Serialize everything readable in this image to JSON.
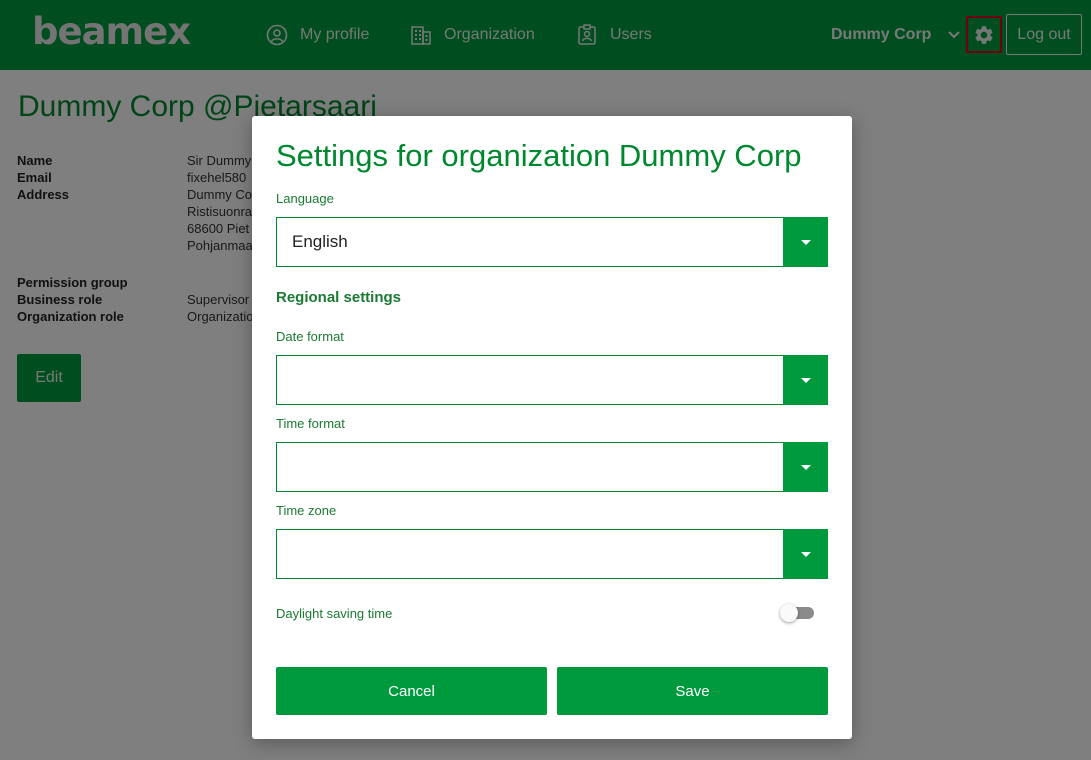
{
  "header": {
    "logo": "beamex",
    "nav": [
      {
        "label": "My profile",
        "icon": "user-circle-icon"
      },
      {
        "label": "Organization",
        "icon": "building-icon"
      },
      {
        "label": "Users",
        "icon": "id-badge-icon"
      }
    ],
    "org_selector": "Dummy Corp",
    "logout_label": "Log out"
  },
  "page": {
    "title": "Dummy Corp @Pietarsaari",
    "details": [
      {
        "label": "Name",
        "value": "Sir Dummy"
      },
      {
        "label": "Email",
        "value": "fixehel580"
      },
      {
        "label": "Address",
        "value": "Dummy Co"
      }
    ],
    "address_lines": [
      "Ristisuonra",
      "68600 Piet",
      "Pohjanmaa"
    ],
    "details2": [
      {
        "label": "Permission group",
        "value": ""
      },
      {
        "label": "Business role",
        "value": "Supervisor"
      },
      {
        "label": "Organization role",
        "value": "Organizatio"
      }
    ],
    "edit_label": "Edit"
  },
  "modal": {
    "title": "Settings for organization Dummy Corp",
    "language_label": "Language",
    "language_value": "English",
    "regional_title": "Regional settings",
    "date_format_label": "Date format",
    "date_format_value": "",
    "time_format_label": "Time format",
    "time_format_value": "",
    "time_zone_label": "Time zone",
    "time_zone_value": "",
    "dst_label": "Daylight saving time",
    "dst_enabled": false,
    "cancel_label": "Cancel",
    "save_label": "Save"
  },
  "colors": {
    "brand_green": "#009a3e",
    "title_green": "#00882f",
    "highlight_red": "#e0001b"
  }
}
